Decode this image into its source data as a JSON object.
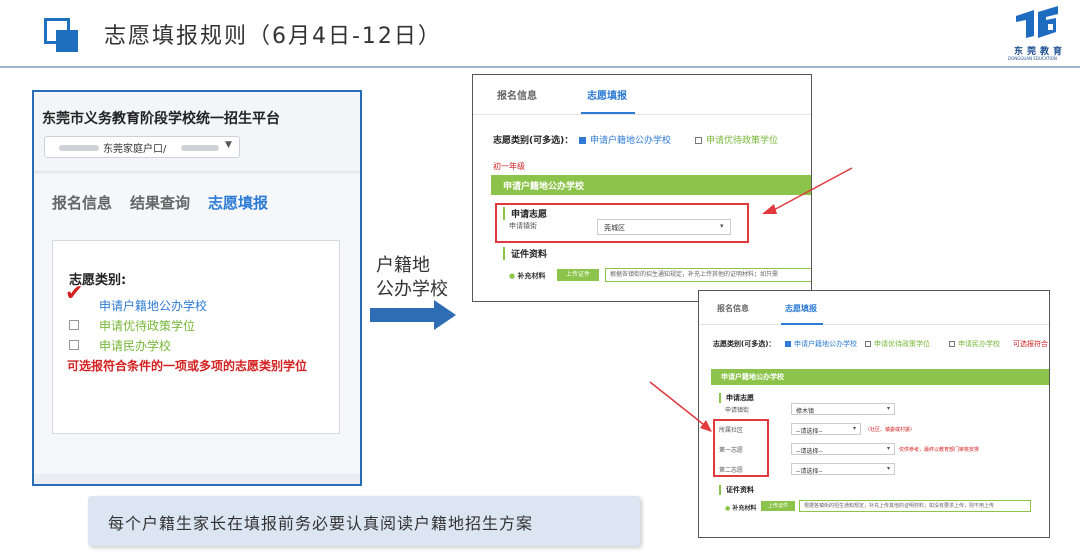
{
  "header": {
    "title": "志愿填报规则（6月4日-12日）",
    "brand_cn": "东莞教育",
    "brand_en": "DONGGUAN EDUCATION",
    "accent_color": "#1f6fbf"
  },
  "panel1": {
    "platform_title": "东莞市义务教育阶段学校统一招生平台",
    "account_select": "东莞家庭户口/",
    "tabs": [
      "报名信息",
      "结果查询",
      "志愿填报"
    ],
    "active_tab": "志愿填报",
    "category_label": "志愿类别:",
    "options": [
      {
        "label": "申请户籍地公办学校",
        "checked": true,
        "color": "blue"
      },
      {
        "label": "申请优待政策学位",
        "checked": false,
        "color": "green"
      },
      {
        "label": "申请民办学校",
        "checked": false,
        "color": "green"
      }
    ],
    "note": "可选报符合条件的一项或多项的志愿类别学位"
  },
  "arrow": {
    "line1": "户籍地",
    "line2": "公办学校",
    "color": "#2e6db4"
  },
  "panel2": {
    "tabs": [
      "报名信息",
      "志愿填报"
    ],
    "type_label": "志愿类别(可多选)：",
    "options": [
      "申请户籍地公办学校",
      "申请优待政策学位"
    ],
    "grade": "初一年级",
    "bar_title": "申请户籍地公办学校",
    "section_apply": "申请志愿",
    "field_town": "申请镇街",
    "town_value": "莞城区",
    "section_docs": "证件资料",
    "extra_label": "补充材料",
    "upload_button": "上传证件",
    "upload_tip": "根据各镇街的招生通知规定，补充上传其他的证明材料；如只需"
  },
  "panel3": {
    "tabs": [
      "报名信息",
      "志愿填报"
    ],
    "type_label": "志愿类别(可多选)：",
    "options": [
      "申请户籍地公办学校",
      "申请优待政策学位",
      "申请民办学校",
      "可选报符合"
    ],
    "bar_title": "申请户籍地公办学校",
    "section_apply": "申请志愿",
    "field_town": "申请镇街",
    "town_value": "樟木镇",
    "field_community": "所属社区",
    "community_value": "--请选择--",
    "community_hint": "（社区、镇委或村委）",
    "field_first": "第一志愿",
    "first_value": "--请选择--",
    "first_hint": "仅供参考，最终以教育部门审核安排",
    "field_second": "第二志愿",
    "second_value": "--请选择--",
    "section_docs": "证件资料",
    "extra_label": "补充材料",
    "upload_button": "上传证件",
    "upload_tip": "根据各镇街的招生通知规定，补充上传其他的证明材料；如没有要求上传，则不用上传"
  },
  "bottom_note": "每个户籍生家长在填报前务必要认真阅读户籍地招生方案"
}
